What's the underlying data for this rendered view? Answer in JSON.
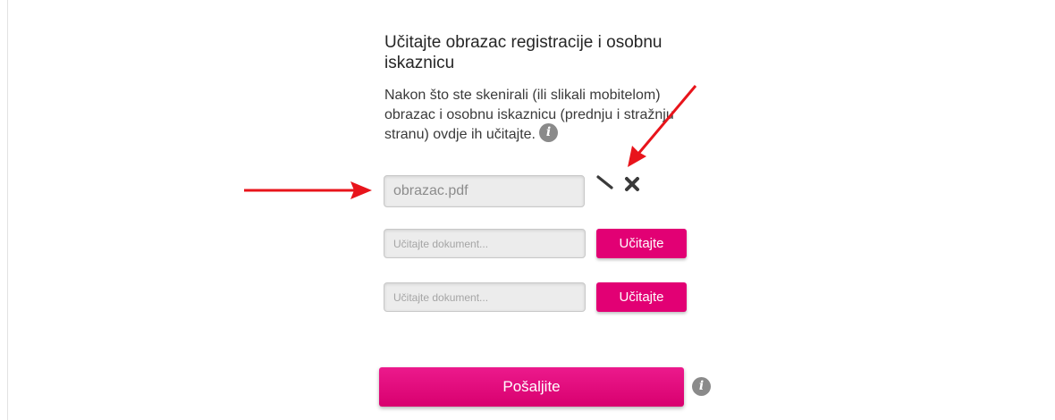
{
  "form": {
    "heading": "Učitajte obrazac registracije i osobnu iskaznicu",
    "description_lines": [
      "Nakon što ste skenirali (ili slikali mobitelom)",
      "obrazac i osobnu iskaznicu (prednju i stražnju",
      "stranu) ovdje ih učitajte."
    ],
    "info_glyph": "i",
    "uploads": [
      {
        "value": "obrazac.pdf",
        "placeholder": "",
        "edit_icon": "pencil-icon",
        "remove_icon": "close-icon"
      },
      {
        "value": "",
        "placeholder": "Učitajte dokument...",
        "button_label": "Učitajte"
      },
      {
        "value": "",
        "placeholder": "Učitajte dokument...",
        "button_label": "Učitajte"
      }
    ],
    "submit_label": "Pošaljite"
  },
  "colors": {
    "accent": "#e20074",
    "annotation_arrow": "#e8141b",
    "info_icon": "#8a8a8a"
  }
}
